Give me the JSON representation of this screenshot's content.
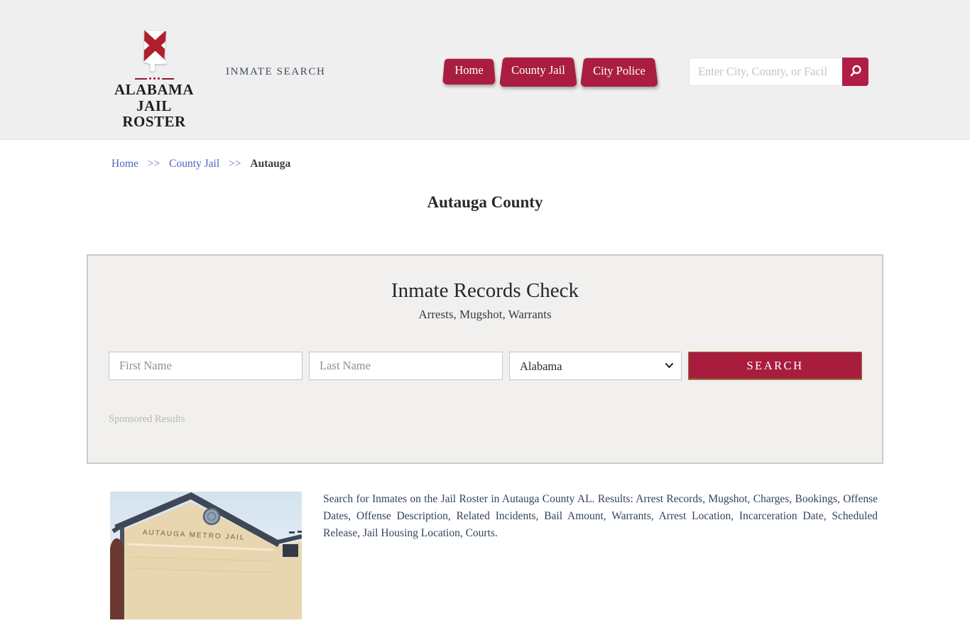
{
  "header": {
    "logo": {
      "line1": "ALABAMA",
      "line2": "JAIL ROSTER"
    },
    "tagline": "INMATE SEARCH",
    "nav": [
      {
        "label": "Home"
      },
      {
        "label": "County Jail"
      },
      {
        "label": "City Police"
      }
    ],
    "search": {
      "placeholder": "Enter City, County, or Facil"
    }
  },
  "breadcrumb": {
    "separator": ">>",
    "home": "Home",
    "county_jail": "County Jail",
    "current": "Autauga"
  },
  "page": {
    "title": "Autauga County"
  },
  "records_panel": {
    "title": "Inmate Records Check",
    "subtitle": "Arrests, Mugshot, Warrants",
    "first_name_placeholder": "First Name",
    "last_name_placeholder": "Last Name",
    "state_selected": "Alabama",
    "search_button": "SEARCH",
    "sponsored_label": "Sponsored Results"
  },
  "content": {
    "jail_image_caption": "AUTAUGA METRO JAIL",
    "description": "Search for Inmates on the Jail Roster in Autauga County AL. Results: Arrest Records, Mugshot, Charges, Bookings, Offense Dates, Offense Description, Related Incidents, Bail Amount, Warrants, Arrest Location, Incarceration Date, Scheduled Release, Jail Housing Location, Courts."
  },
  "colors": {
    "accent": "#a91e40",
    "header_bg": "#efefef",
    "link": "#4a66c4"
  }
}
